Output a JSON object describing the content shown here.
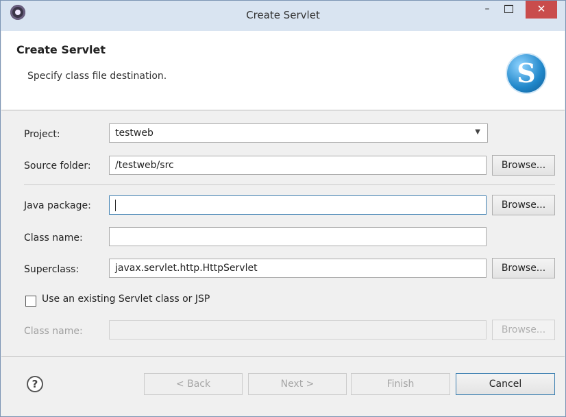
{
  "window": {
    "title": "Create Servlet"
  },
  "header": {
    "title": "Create Servlet",
    "description": "Specify class file destination.",
    "logo_letter": "S"
  },
  "form": {
    "project_label": "Project:",
    "project_value": "testweb",
    "source_folder_label": "Source folder:",
    "source_folder_value": "/testweb/src",
    "java_package_label": "Java package:",
    "java_package_value": "",
    "class_name_label": "Class name:",
    "class_name_value": "",
    "superclass_label": "Superclass:",
    "superclass_value": "javax.servlet.http.HttpServlet",
    "browse_label": "Browse...",
    "use_existing_label": "Use an existing Servlet class or JSP",
    "existing_class_label": "Class name:",
    "existing_class_value": ""
  },
  "footer": {
    "help_symbol": "?",
    "back_label": "< Back",
    "next_label": "Next >",
    "finish_label": "Finish",
    "cancel_label": "Cancel"
  },
  "colors": {
    "close_button": "#c94c4c",
    "titlebar": "#d9e4f1",
    "focus_border": "#3c7fb1"
  }
}
